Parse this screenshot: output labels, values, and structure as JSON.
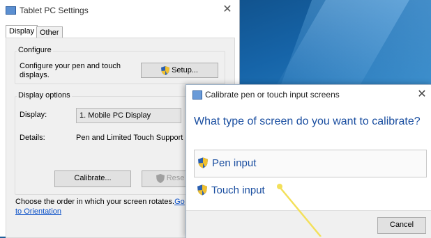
{
  "settings_window": {
    "title": "Tablet PC Settings",
    "tabs": [
      {
        "label": "Display",
        "active": true
      },
      {
        "label": "Other",
        "active": false
      }
    ],
    "configure": {
      "group_title": "Configure",
      "description_line1": "Configure your pen and touch",
      "description_line2": "displays.",
      "setup_label": "Setup..."
    },
    "display_options": {
      "group_title": "Display options",
      "display_label": "Display:",
      "display_value": "1. Mobile PC Display",
      "details_label": "Details:",
      "details_value": "Pen and Limited Touch Support",
      "calibrate_label": "Calibrate...",
      "reset_label": "Rese"
    },
    "rotation_text": "Choose the order in which your screen rotates.",
    "rotation_link_part1": "Go",
    "rotation_link_part2": "to Orientation"
  },
  "calibrate_dialog": {
    "title": "Calibrate pen or touch input screens",
    "question": "What type of screen do you want to calibrate?",
    "options": [
      {
        "label": "Pen input",
        "highlighted": true
      },
      {
        "label": "Touch input",
        "highlighted": false
      }
    ],
    "cancel_label": "Cancel"
  },
  "colors": {
    "accent_text": "#1a4ea0",
    "pointer": "#f3e05a",
    "desktop": "#1664a8"
  }
}
